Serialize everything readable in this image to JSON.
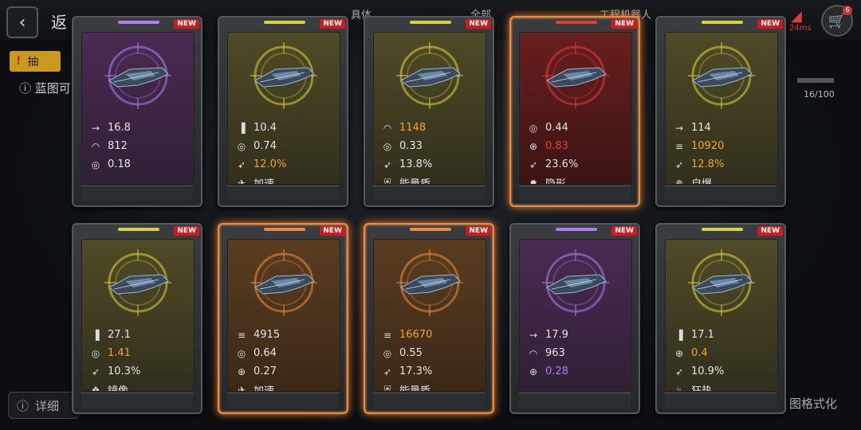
{
  "topbar": {
    "back_label": "返",
    "tabs": [
      "具体",
      "全部",
      "工程机器人"
    ],
    "ping": "24ms",
    "cart_badge": "6"
  },
  "background": {
    "tab_label": "抽",
    "info_text": "蓝图可",
    "progress": "16/100",
    "bottom_left": "详细",
    "bottom_right": "图格式化"
  },
  "colors": {
    "purple": "#b07cf0",
    "yellow": "#d8d23a",
    "orange": "#f08a3a",
    "red": "#e33a3a",
    "new_badge": "#c81e1e"
  },
  "cards": [
    {
      "tier": "purple",
      "new": "NEW",
      "glow": false,
      "stats": [
        {
          "icon": "arrow-icon",
          "value": "16.8",
          "color": ""
        },
        {
          "icon": "armor-icon",
          "value": "812",
          "color": ""
        },
        {
          "icon": "target-icon",
          "value": "0.18",
          "color": ""
        }
      ]
    },
    {
      "tier": "yellow",
      "new": "NEW",
      "glow": false,
      "stats": [
        {
          "icon": "ammo-icon",
          "value": "10.4",
          "color": ""
        },
        {
          "icon": "target-icon",
          "value": "0.74",
          "color": ""
        },
        {
          "icon": "rocket-icon",
          "value": "12.0%",
          "color": "orange"
        },
        {
          "icon": "boost-icon",
          "value": "加速",
          "color": ""
        }
      ]
    },
    {
      "tier": "yellow",
      "new": "NEW",
      "glow": false,
      "stats": [
        {
          "icon": "armor-icon",
          "value": "1148",
          "color": "orange"
        },
        {
          "icon": "target-icon",
          "value": "0.33",
          "color": ""
        },
        {
          "icon": "rocket-icon",
          "value": "13.8%",
          "color": ""
        },
        {
          "icon": "shield-icon",
          "value": "能量盾",
          "color": ""
        }
      ]
    },
    {
      "tier": "red",
      "new": "NEW",
      "glow": true,
      "stats": [
        {
          "icon": "target-icon",
          "value": "0.44",
          "color": ""
        },
        {
          "icon": "crosshair-icon",
          "value": "0.83",
          "color": "red"
        },
        {
          "icon": "rocket-icon",
          "value": "23.6%",
          "color": ""
        },
        {
          "icon": "stealth-icon",
          "value": "隐形",
          "color": ""
        }
      ]
    },
    {
      "tier": "yellow",
      "new": "NEW",
      "glow": false,
      "stats": [
        {
          "icon": "arrow-icon",
          "value": "114",
          "color": ""
        },
        {
          "icon": "hp-icon",
          "value": "10920",
          "color": "orange"
        },
        {
          "icon": "rocket-icon",
          "value": "12.8%",
          "color": "orange"
        },
        {
          "icon": "explode-icon",
          "value": "自爆",
          "color": ""
        }
      ]
    },
    {
      "tier": "yellow",
      "new": "NEW",
      "glow": false,
      "stats": [
        {
          "icon": "ammo-icon",
          "value": "27.1",
          "color": ""
        },
        {
          "icon": "target-icon",
          "value": "1.41",
          "color": "orange"
        },
        {
          "icon": "rocket-icon",
          "value": "10.3%",
          "color": ""
        },
        {
          "icon": "mirror-icon",
          "value": "镜像",
          "color": ""
        }
      ]
    },
    {
      "tier": "orange",
      "new": "NEW",
      "glow": true,
      "stats": [
        {
          "icon": "hp-icon",
          "value": "4915",
          "color": ""
        },
        {
          "icon": "target-icon",
          "value": "0.64",
          "color": ""
        },
        {
          "icon": "crosshair-icon",
          "value": "0.27",
          "color": ""
        },
        {
          "icon": "boost-icon",
          "value": "加速",
          "color": ""
        }
      ]
    },
    {
      "tier": "orange",
      "new": "NEW",
      "glow": true,
      "stats": [
        {
          "icon": "hp-icon",
          "value": "16670",
          "color": "orange"
        },
        {
          "icon": "target-icon",
          "value": "0.55",
          "color": ""
        },
        {
          "icon": "rocket-icon",
          "value": "17.3%",
          "color": ""
        },
        {
          "icon": "shield-icon",
          "value": "能量盾",
          "color": ""
        }
      ]
    },
    {
      "tier": "purple",
      "new": "NEW",
      "glow": false,
      "stats": [
        {
          "icon": "arrow-icon",
          "value": "17.9",
          "color": ""
        },
        {
          "icon": "armor-icon",
          "value": "963",
          "color": ""
        },
        {
          "icon": "crosshair-icon",
          "value": "0.28",
          "color": "purple"
        }
      ]
    },
    {
      "tier": "yellow",
      "new": "NEW",
      "glow": false,
      "stats": [
        {
          "icon": "ammo-icon",
          "value": "17.1",
          "color": ""
        },
        {
          "icon": "crosshair-icon",
          "value": "0.4",
          "color": "orange"
        },
        {
          "icon": "rocket-icon",
          "value": "10.9%",
          "color": ""
        },
        {
          "icon": "rage-icon",
          "value": "狂热",
          "color": ""
        }
      ]
    }
  ]
}
